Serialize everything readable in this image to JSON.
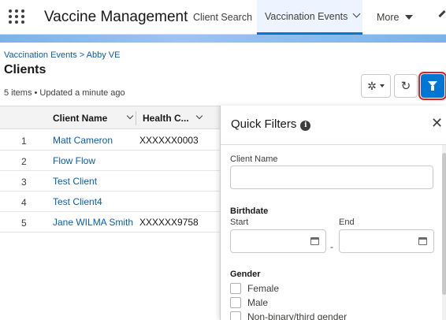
{
  "app": {
    "title": "Vaccine Management"
  },
  "nav": {
    "tabs": [
      {
        "label": "Client Search"
      },
      {
        "label": "Vaccination Events"
      },
      {
        "label": "More"
      }
    ]
  },
  "list": {
    "breadcrumb": "Vaccination Events > Abby VE",
    "title": "Clients",
    "meta": "5 items • Updated a minute ago",
    "columns": [
      "Client Name",
      "Health C..."
    ],
    "rows": [
      {
        "num": "1",
        "name": "Matt Cameron",
        "health": "XXXXXX0003"
      },
      {
        "num": "2",
        "name": "Flow Flow",
        "health": ""
      },
      {
        "num": "3",
        "name": "Test Client",
        "health": ""
      },
      {
        "num": "4",
        "name": "Test Client4",
        "health": ""
      },
      {
        "num": "5",
        "name": "Jane WILMA Smith",
        "health": "XXXXXX9758"
      }
    ]
  },
  "icons": {
    "settings": "gear-icon",
    "refresh": "refresh-icon",
    "filter": "filter-icon",
    "close": "close-icon",
    "info": "info-icon",
    "calendar": "calendar-icon"
  },
  "filters": {
    "title": "Quick Filters",
    "client_name_label": "Client Name",
    "birthdate_label": "Birthdate",
    "start_label": "Start",
    "end_label": "End",
    "range_sep": "-",
    "gender_label": "Gender",
    "gender_options": [
      "Female",
      "Male",
      "Non-binary/third gender"
    ]
  },
  "colors": {
    "accent": "#0176d3",
    "link": "#0b5cab",
    "highlight_outline": "#e02020"
  }
}
